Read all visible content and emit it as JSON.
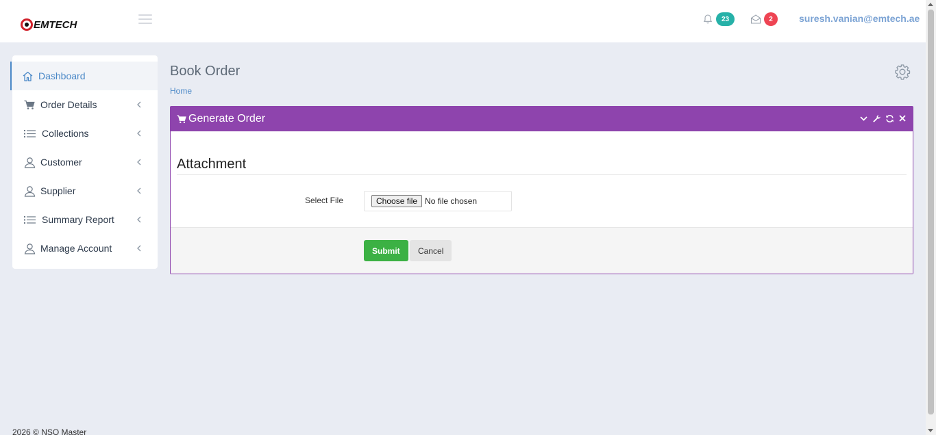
{
  "header": {
    "logo_text": "EMTECH",
    "notifications_count": "23",
    "messages_count": "2",
    "user_email": "suresh.vanian@emtech.ae"
  },
  "sidebar": {
    "items": [
      {
        "label": "Dashboard",
        "icon": "home-icon"
      },
      {
        "label": "Order Details",
        "icon": "cart-icon"
      },
      {
        "label": "Collections",
        "icon": "list-icon"
      },
      {
        "label": "Customer",
        "icon": "user-icon"
      },
      {
        "label": "Supplier",
        "icon": "user-icon"
      },
      {
        "label": "Summary Report",
        "icon": "list-icon"
      },
      {
        "label": "Manage Account",
        "icon": "user-icon"
      }
    ]
  },
  "page": {
    "title": "Book Order",
    "breadcrumb": "Home"
  },
  "panel": {
    "title": "Generate Order",
    "section_title": "Attachment",
    "field_label": "Select File",
    "file_button": "Choose file",
    "file_status": "No file chosen",
    "submit_label": "Submit",
    "cancel_label": "Cancel"
  },
  "footer": {
    "text": "2026 © NSO Master"
  },
  "colors": {
    "panel_accent": "#8e44ad",
    "link": "#4a88c7",
    "submit": "#3cb144",
    "badge_teal": "#26b1a8",
    "badge_red": "#ee4453"
  }
}
